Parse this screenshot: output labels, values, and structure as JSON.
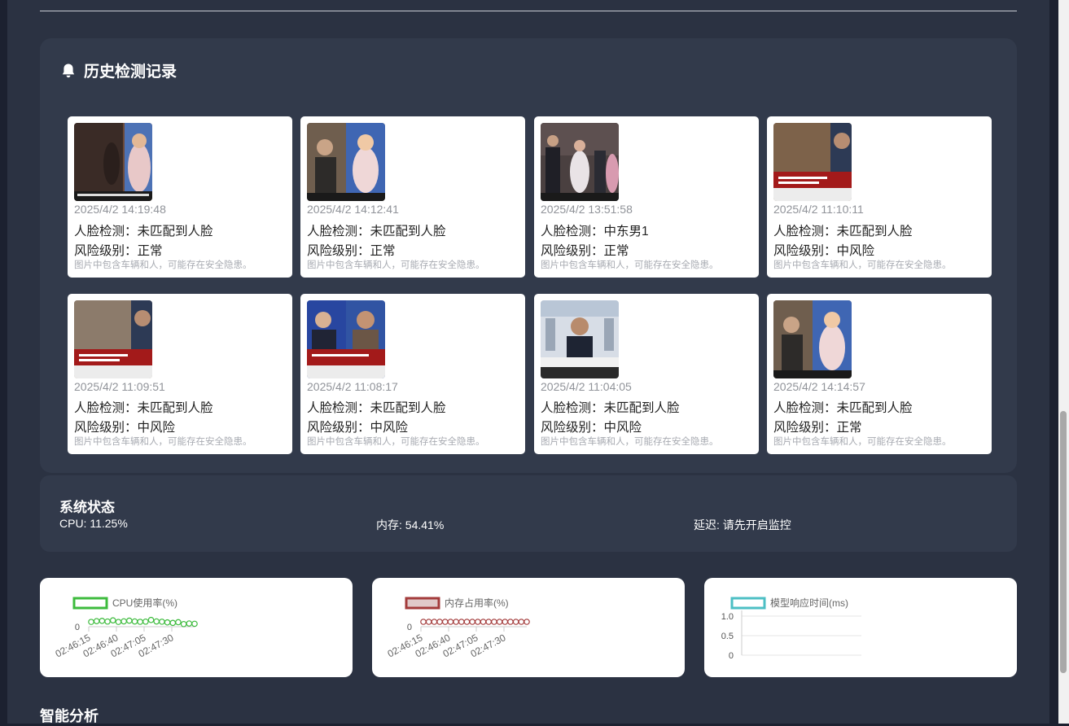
{
  "history": {
    "title": "历史检测记录",
    "records": [
      {
        "time": "2025/4/2 14:19:48",
        "face": "人脸检测：未匹配到人脸",
        "risk": "风险级别：正常",
        "desc": "图片中包含车辆和人，可能存在安全隐患。"
      },
      {
        "time": "2025/4/2 14:12:41",
        "face": "人脸检测：未匹配到人脸",
        "risk": "风险级别：正常",
        "desc": "图片中包含车辆和人，可能存在安全隐患。"
      },
      {
        "time": "2025/4/2 13:51:58",
        "face": "人脸检测：中东男1",
        "risk": "风险级别：正常",
        "desc": "图片中包含车辆和人，可能存在安全隐患。"
      },
      {
        "time": "2025/4/2 11:10:11",
        "face": "人脸检测：未匹配到人脸",
        "risk": "风险级别：中风险",
        "desc": "图片中包含车辆和人，可能存在安全隐患。"
      },
      {
        "time": "2025/4/2 11:09:51",
        "face": "人脸检测：未匹配到人脸",
        "risk": "风险级别：中风险",
        "desc": "图片中包含车辆和人，可能存在安全隐患。"
      },
      {
        "time": "2025/4/2 11:08:17",
        "face": "人脸检测：未匹配到人脸",
        "risk": "风险级别：中风险",
        "desc": "图片中包含车辆和人，可能存在安全隐患。"
      },
      {
        "time": "2025/4/2 11:04:05",
        "face": "人脸检测：未匹配到人脸",
        "risk": "风险级别：中风险",
        "desc": "图片中包含车辆和人，可能存在安全隐患。"
      },
      {
        "time": "2025/4/2 14:14:57",
        "face": "人脸检测：未匹配到人脸",
        "risk": "风险级别：正常",
        "desc": "图片中包含车辆和人，可能存在安全隐患。"
      }
    ]
  },
  "status": {
    "title": "系统状态",
    "cpu": "CPU: 11.25%",
    "memory": "内存: 54.41%",
    "latency": "延迟: 请先开启监控"
  },
  "chart_data": [
    {
      "type": "line",
      "series": [
        {
          "name": "CPU使用率(%)",
          "values": [
            11.8,
            12.6,
            12.9,
            12.2,
            13.4,
            11.8,
            12.4,
            13.1,
            12.3,
            11.9,
            12.1,
            13.8,
            12.3,
            12.0,
            11.3,
            10.8,
            11.5,
            9.6,
            10.2,
            9.9
          ]
        }
      ],
      "x": [
        "02:46:15",
        "02:46:40",
        "02:47:05",
        "02:47:30"
      ],
      "ytick": "0",
      "color": "#3dbb3d"
    },
    {
      "type": "line",
      "series": [
        {
          "name": "内存占用率(%)",
          "values": [
            54.4,
            54.4,
            54.4,
            54.4,
            54.4,
            54.4,
            54.4,
            54.4,
            54.4,
            54.4,
            54.4,
            54.4,
            54.4,
            54.4,
            54.4,
            54.4,
            54.4,
            54.4,
            54.4,
            54.4
          ]
        }
      ],
      "x": [
        "02:46:15",
        "02:46:40",
        "02:47:05",
        "02:47:30"
      ],
      "ytick": "0",
      "color": "#a33b3b"
    },
    {
      "type": "line",
      "series": [
        {
          "name": "模型响应时间(ms)",
          "values": []
        }
      ],
      "yticks": [
        "1.0",
        "0.5",
        "0"
      ],
      "color": "#4dbfc4"
    }
  ],
  "smart": {
    "title": "智能分析"
  }
}
